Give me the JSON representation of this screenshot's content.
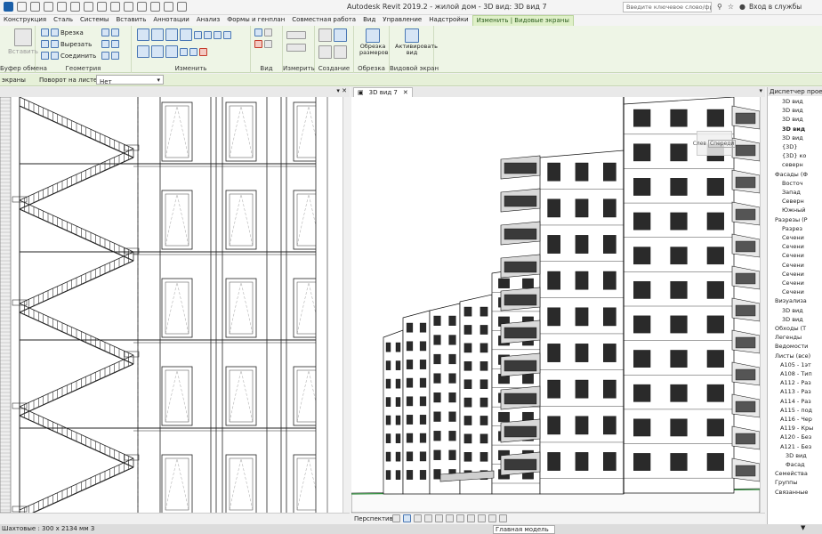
{
  "window": {
    "title": "Autodesk Revit 2019.2 - жилой дом - 3D вид: 3D вид 7",
    "search_placeholder": "Введите ключевое слово/фразу",
    "login": "Вход в службы"
  },
  "ribbon_tabs": [
    {
      "label": "Конструкция"
    },
    {
      "label": "Сталь"
    },
    {
      "label": "Системы"
    },
    {
      "label": "Вставить"
    },
    {
      "label": "Аннотации"
    },
    {
      "label": "Анализ"
    },
    {
      "label": "Формы и генплан"
    },
    {
      "label": "Совместная работа"
    },
    {
      "label": "Вид"
    },
    {
      "label": "Управление"
    },
    {
      "label": "Надстройки"
    },
    {
      "label": "Изменить | Видовые экраны"
    }
  ],
  "ribbon": {
    "clipboard": {
      "paste": "Вставить",
      "label": "Буфер обмена"
    },
    "geometry": {
      "cut": "Врезка",
      "cutout": "Вырезать",
      "join": "Соединить",
      "label": "Геометрия"
    },
    "modify": {
      "label": "Изменить"
    },
    "view": {
      "label": "Вид"
    },
    "measure": {
      "label": "Измерить"
    },
    "create": {
      "label": "Создание"
    },
    "crop": {
      "btn": "Обрезка размеров",
      "label": "Обрезка"
    },
    "viewport": {
      "btn": "Активировать вид",
      "label": "Видовой экран"
    }
  },
  "options_bar": {
    "left": "экраны",
    "rotation_label": "Поворот на листе:",
    "rotation_value": "Нет"
  },
  "view_tabs": {
    "active": "3D вид 7"
  },
  "view_cube_labels": {
    "left": "Слев",
    "front": "Спереди"
  },
  "view_control_bar": {
    "label": "Перспектива"
  },
  "browser": {
    "title": "Диспетчер проекта",
    "nodes": [
      {
        "label": "3D вид"
      },
      {
        "label": "3D вид"
      },
      {
        "label": "3D вид"
      },
      {
        "label": "3D вид",
        "bold": true
      },
      {
        "label": "3D вид"
      },
      {
        "label": "{3D}"
      },
      {
        "label": "{3D} ко"
      },
      {
        "label": "северн"
      },
      {
        "label": "Фасады (Ф"
      },
      {
        "label": "Восточ"
      },
      {
        "label": "Запад"
      },
      {
        "label": "Северн"
      },
      {
        "label": "Южный"
      },
      {
        "label": "Разрезы (Р"
      },
      {
        "label": "Разрез"
      },
      {
        "label": "Сечени"
      },
      {
        "label": "Сечени"
      },
      {
        "label": "Сечени"
      },
      {
        "label": "Сечени"
      },
      {
        "label": "Сечени"
      },
      {
        "label": "Сечени"
      },
      {
        "label": "Сечени"
      },
      {
        "label": "Визуализа"
      },
      {
        "label": "3D вид"
      },
      {
        "label": "3D вид"
      },
      {
        "label": "Обходы (Т"
      },
      {
        "label": "Легенды"
      },
      {
        "label": "Ведомости"
      },
      {
        "label": "Листы (все)"
      },
      {
        "label": "А105 - 1эт"
      },
      {
        "label": "А108 - Тип"
      },
      {
        "label": "А112 - Раз"
      },
      {
        "label": "А113 - Раз"
      },
      {
        "label": "А114 - Раз"
      },
      {
        "label": "А115 - под"
      },
      {
        "label": "А116 - Чер"
      },
      {
        "label": "А119 - Кры"
      },
      {
        "label": "А120 - Без"
      },
      {
        "label": "А121 - Без"
      },
      {
        "label": "3D вид"
      },
      {
        "label": "Фасад"
      },
      {
        "label": "Семейства"
      },
      {
        "label": "Группы"
      },
      {
        "label": "Связанные"
      }
    ]
  },
  "status": {
    "left": "Шахтовые : 300 x 2134 мм 3",
    "model": "Главная модель"
  }
}
